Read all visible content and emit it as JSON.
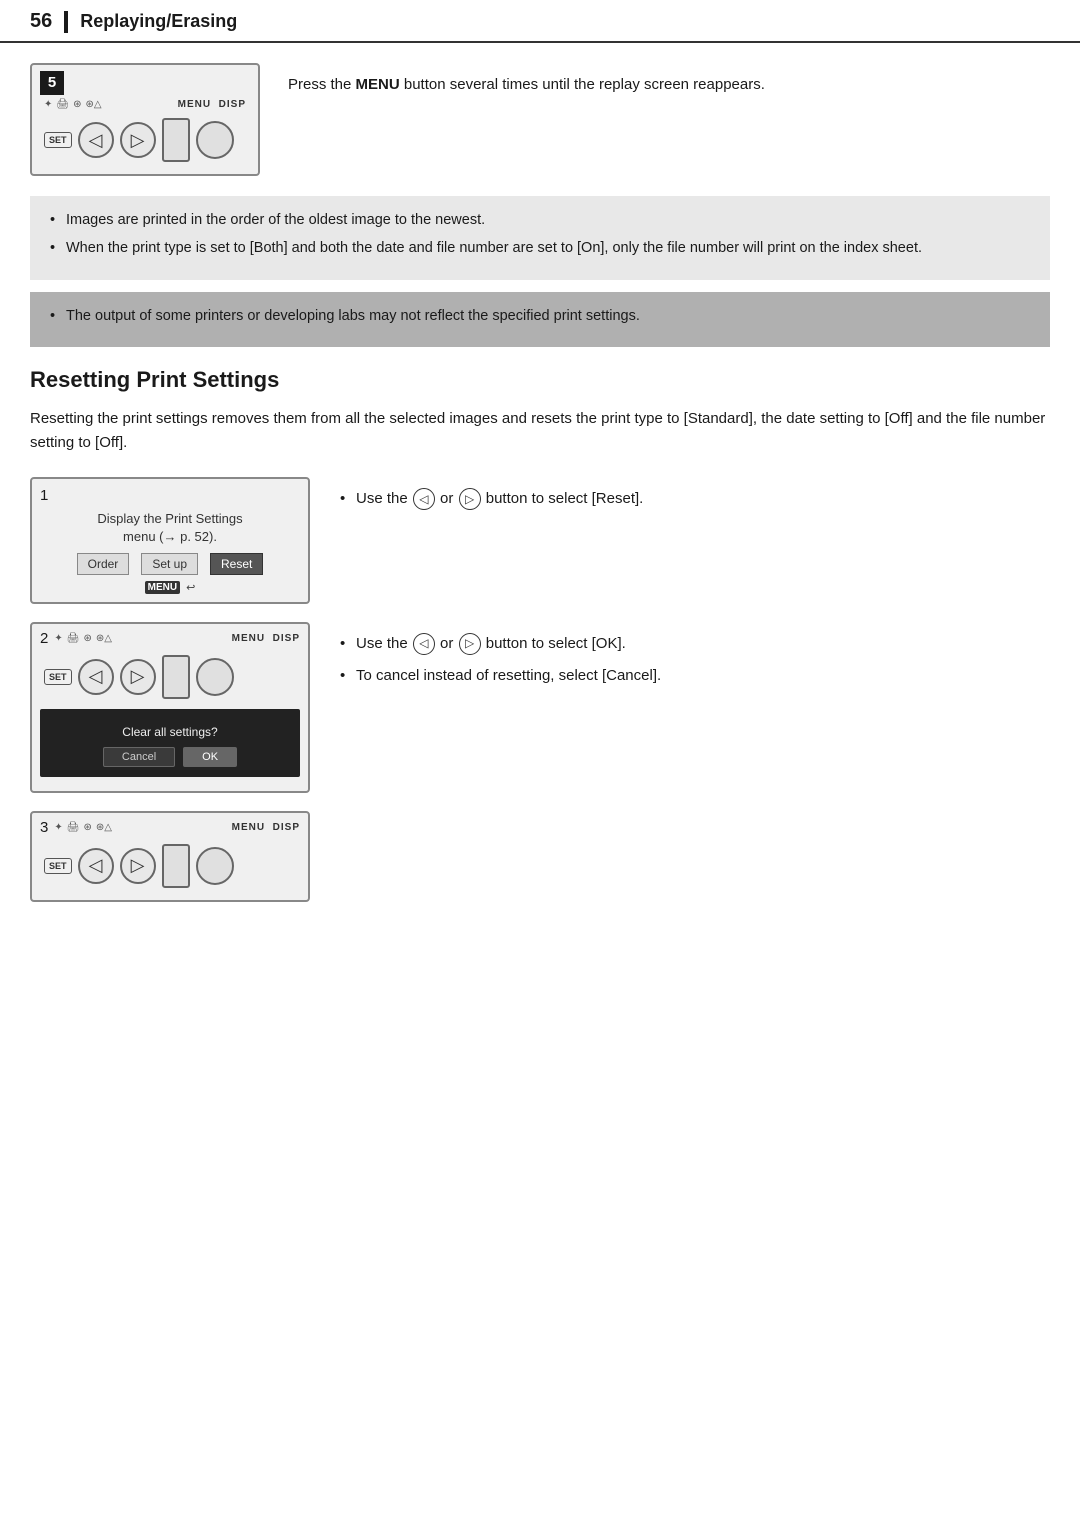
{
  "header": {
    "page_number": "56",
    "divider": "|",
    "title": "Replaying/Erasing"
  },
  "step5": {
    "badge": "5",
    "instruction": "Press the MENU button several times until the replay screen reappears.",
    "instruction_bold": "MENU"
  },
  "info_box_light": {
    "items": [
      "Images are printed in the order of the oldest image to the newest.",
      "When the print type is set to [Both] and both the date and file number are set to [On], only the file number will print on the index sheet."
    ]
  },
  "info_box_dark": {
    "items": [
      "The output of some printers or developing labs may not reflect the specified print settings."
    ]
  },
  "section": {
    "title": "Resetting Print Settings",
    "body": "Resetting the print settings removes them from all the selected images and resets the print type to [Standard], the date setting to [Off] and the file number setting to [Off]."
  },
  "step1": {
    "badge": "1",
    "screen_label": "Display the Print Settings menu (→ p. 52).",
    "menu_items": [
      "Order",
      "Set up",
      "Reset"
    ],
    "active_menu": "Reset",
    "menu_bottom": "MENU ↩",
    "instruction": "Use the ◁ or ▷ button to select [Reset].",
    "instruction_left_icon": "◁",
    "instruction_right_icon": "▷"
  },
  "step2": {
    "badge": "2",
    "dialog_text": "Clear all settings?",
    "btn_cancel": "Cancel",
    "btn_ok": "OK",
    "instructions": [
      "Use the ◁ or ▷ button to select [OK].",
      "To cancel instead of resetting, select [Cancel]."
    ]
  },
  "step3": {
    "badge": "3"
  },
  "camera": {
    "icons_left": [
      "✦",
      "🖨",
      "⊙",
      "⊙△"
    ],
    "menu_disp": "MENU  DISP",
    "set_label": "SET",
    "left_arrow": "◁",
    "right_arrow": "▷"
  }
}
